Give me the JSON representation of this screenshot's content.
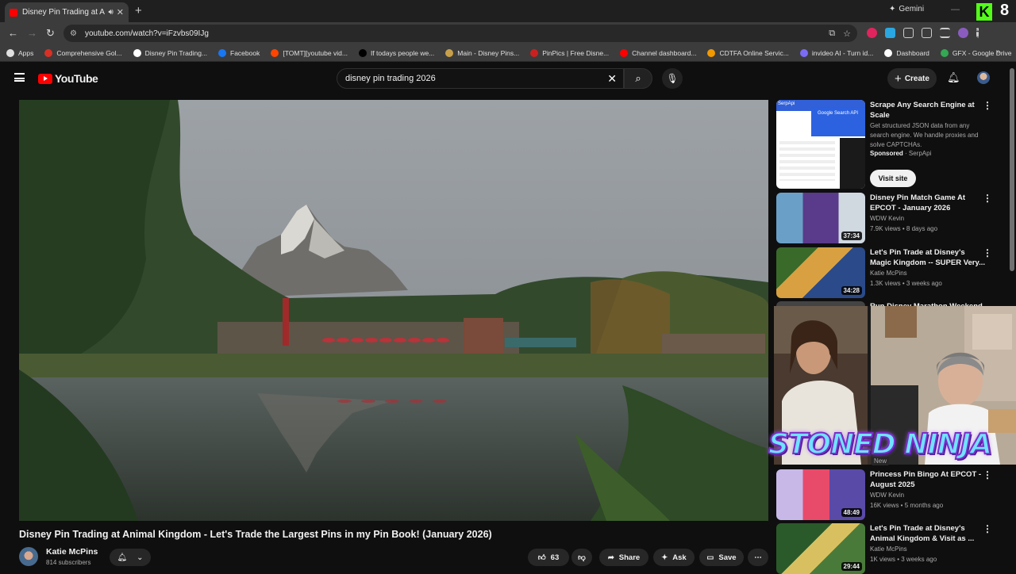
{
  "browser": {
    "tab_title": "Disney Pin Trading at Anim",
    "url": "youtube.com/watch?v=iFzvbs09IJg",
    "gemini_label": "Gemini",
    "kick_letter": "K",
    "overlay_number": "8",
    "bookmarks": [
      {
        "label": "Apps",
        "color": "#e0e0e0"
      },
      {
        "label": "Comprehensive Gol...",
        "color": "#d93025"
      },
      {
        "label": "Disney Pin Trading...",
        "color": "#ffffff"
      },
      {
        "label": "Facebook",
        "color": "#1877f2"
      },
      {
        "label": "[TOMT][youtube vid...",
        "color": "#ff4500"
      },
      {
        "label": "If todays people we...",
        "color": "#000000"
      },
      {
        "label": "Main - Disney Pins...",
        "color": "#c9a04a"
      },
      {
        "label": "PinPics | Free Disne...",
        "color": "#cc2020"
      },
      {
        "label": "Channel dashboard...",
        "color": "#ff0000"
      },
      {
        "label": "CDTFA Online Servic...",
        "color": "#f29900"
      },
      {
        "label": "invideo AI - Turn id...",
        "color": "#7b6cf6"
      },
      {
        "label": "Dashboard",
        "color": "#ffffff"
      },
      {
        "label": "GFX - Google Drive",
        "color": "#34a853"
      }
    ]
  },
  "youtube": {
    "logo_text": "YouTube",
    "search_query": "disney pin trading 2026",
    "create_label": "Create"
  },
  "video": {
    "title": "Disney Pin Trading at Animal Kingdom - Let's Trade the Largest Pins in my Pin Book! (January 2026)",
    "channel": "Katie McPins",
    "subscribers": "814 subscribers",
    "likes": "63",
    "share_label": "Share",
    "ask_label": "Ask",
    "save_label": "Save"
  },
  "ad": {
    "title": "Scrape Any Search Engine at Scale",
    "description": "Get structured JSON data from any search engine. We handle proxies and solve CAPTCHAs.",
    "sponsored": "Sponsored",
    "advertiser": "SerpApi",
    "cta": "Visit site",
    "thumb_brand": "SerpApi",
    "thumb_text": "Google Search API"
  },
  "recommendations": [
    {
      "title": "Disney Pin Match Game At EPCOT - January 2026",
      "channel": "WDW Kevin",
      "meta": "7.9K views • 8 days ago",
      "duration": "37:34"
    },
    {
      "title": "Let's Pin Trade at Disney's Magic Kingdom -- SUPER Very...",
      "channel": "Katie McPins",
      "meta": "1.3K views • 3 weeks ago",
      "duration": "34:28"
    },
    {
      "title": "Run Disney Marathon Weekend",
      "channel": "",
      "meta": "",
      "duration": ""
    },
    {
      "title": "Princess Pin Bingo At EPCOT - August 2025",
      "channel": "WDW Kevin",
      "meta": "16K views • 5 months ago",
      "duration": "48:49"
    },
    {
      "title": "Let's Pin Trade at Disney's Animal Kingdom & Visit as ...",
      "channel": "Katie McPins",
      "meta": "1K views • 3 weeks ago",
      "duration": "29:44"
    }
  ],
  "overlay": {
    "text": "STONED NINJA",
    "new_badge": "New"
  }
}
